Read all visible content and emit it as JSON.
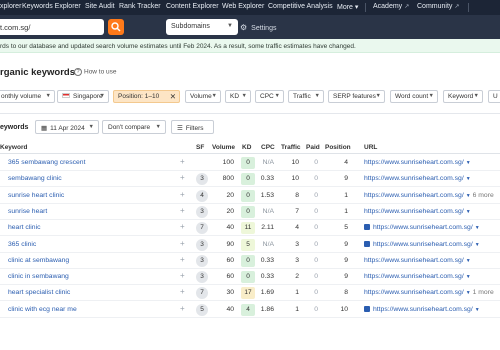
{
  "topnav": {
    "items": [
      "xplorer",
      "Keywords Explorer",
      "Site Audit",
      "Rank Tracker",
      "Content Explorer",
      "Web Explorer",
      "Competitive Analysis",
      "More",
      "Academy",
      "Community"
    ],
    "more_caret": "▾",
    "ext_glyph": "↗"
  },
  "searchbar": {
    "url_value": "t.com.sg/",
    "mode": "Subdomains",
    "settings_label": "Settings"
  },
  "notice": "rds to our database and updated search volume estimates until Feb 2024. As a result, some traffic estimates have changed.",
  "page": {
    "title": "rganic keywords",
    "howto_label": "How to use"
  },
  "filters": [
    {
      "label": "onthly volume",
      "type": "dropdown"
    },
    {
      "label": "Singapore",
      "type": "dropdown",
      "flag": true
    },
    {
      "label": "Position: 1–10",
      "type": "active"
    },
    {
      "label": "Volume",
      "type": "dropdown"
    },
    {
      "label": "KD",
      "type": "dropdown"
    },
    {
      "label": "CPC",
      "type": "dropdown"
    },
    {
      "label": "Traffic",
      "type": "dropdown"
    },
    {
      "label": "SERP features",
      "type": "dropdown"
    },
    {
      "label": "Word count",
      "type": "dropdown"
    },
    {
      "label": "Keyword",
      "type": "dropdown"
    },
    {
      "label": "U",
      "type": "dropdown"
    }
  ],
  "toolbar": {
    "count_label": "eywords",
    "date": "11 Apr 2024",
    "compare": "Don't compare",
    "filters": "Filters"
  },
  "table": {
    "headers": {
      "keyword": "Keyword",
      "sf": "SF",
      "volume": "Volume",
      "kd": "KD",
      "cpc": "CPC",
      "traffic": "Traffic",
      "paid": "Paid",
      "position": "Position",
      "url": "URL"
    },
    "rows": [
      {
        "keyword": "365 sembawang crescent",
        "sf": "",
        "volume": "100",
        "kd": "0",
        "cpc": "N/A",
        "traffic": "10",
        "paid": "0",
        "position": "4",
        "url": "https://www.sunriseheart.com.sg/",
        "more": "",
        "img": false
      },
      {
        "keyword": "sembawang clinic",
        "sf": "3",
        "volume": "800",
        "kd": "0",
        "cpc": "0.33",
        "traffic": "10",
        "paid": "0",
        "position": "9",
        "url": "https://www.sunriseheart.com.sg/",
        "more": "",
        "img": false
      },
      {
        "keyword": "sunrise heart clinic",
        "sf": "4",
        "volume": "20",
        "kd": "0",
        "cpc": "1.53",
        "traffic": "8",
        "paid": "0",
        "position": "1",
        "url": "https://www.sunriseheart.com.sg/",
        "more": "6 more",
        "img": false
      },
      {
        "keyword": "sunrise heart",
        "sf": "3",
        "volume": "20",
        "kd": "0",
        "cpc": "N/A",
        "traffic": "7",
        "paid": "0",
        "position": "1",
        "url": "https://www.sunriseheart.com.sg/",
        "more": "",
        "img": false
      },
      {
        "keyword": "heart clinic",
        "sf": "7",
        "volume": "40",
        "kd": "11",
        "cpc": "2.11",
        "traffic": "4",
        "paid": "0",
        "position": "5",
        "url": "https://www.sunriseheart.com.sg/",
        "more": "",
        "img": true
      },
      {
        "keyword": "365 clinic",
        "sf": "3",
        "volume": "90",
        "kd": "5",
        "cpc": "N/A",
        "traffic": "3",
        "paid": "0",
        "position": "9",
        "url": "https://www.sunriseheart.com.sg/",
        "more": "",
        "img": true
      },
      {
        "keyword": "clinic at sembawang",
        "sf": "3",
        "volume": "60",
        "kd": "0",
        "cpc": "0.33",
        "traffic": "3",
        "paid": "0",
        "position": "9",
        "url": "https://www.sunriseheart.com.sg/",
        "more": "",
        "img": false
      },
      {
        "keyword": "clinic in sembawang",
        "sf": "3",
        "volume": "60",
        "kd": "0",
        "cpc": "0.33",
        "traffic": "2",
        "paid": "0",
        "position": "9",
        "url": "https://www.sunriseheart.com.sg/",
        "more": "",
        "img": false
      },
      {
        "keyword": "heart specialist clinic",
        "sf": "7",
        "volume": "30",
        "kd": "17",
        "cpc": "1.69",
        "traffic": "1",
        "paid": "0",
        "position": "8",
        "url": "https://www.sunriseheart.com.sg/",
        "more": "1 more",
        "img": false
      },
      {
        "keyword": "clinic with ecg near me",
        "sf": "5",
        "volume": "40",
        "kd": "4",
        "cpc": "1.86",
        "traffic": "1",
        "paid": "0",
        "position": "10",
        "url": "https://www.sunriseheart.com.sg/",
        "more": "",
        "img": true
      }
    ]
  },
  "colors": {
    "kd_low": "#d8f0dc",
    "kd_mid": "#eef7d9",
    "kd_high": "#f9edc8",
    "link": "#2a5db0",
    "accent": "#ff7a1a"
  }
}
